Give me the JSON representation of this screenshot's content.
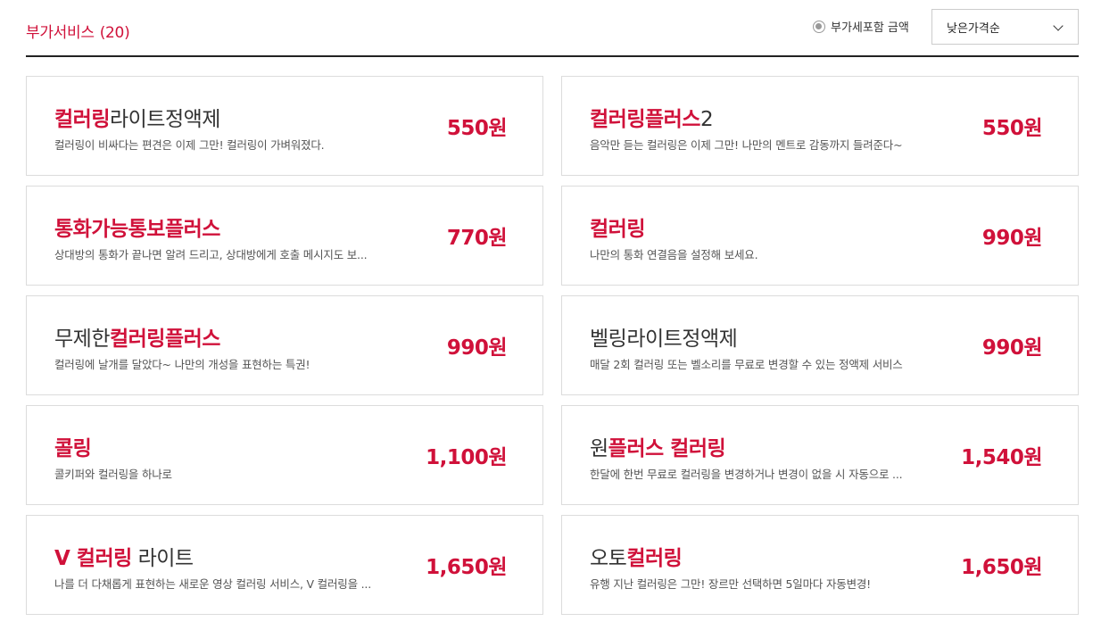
{
  "header": {
    "title": "부가서비스",
    "count": "(20)",
    "vat_label": "부가세포함 금액",
    "sort_value": "낮은가격순"
  },
  "colors": {
    "accent": "#d0113a",
    "text": "#333333",
    "border": "#dcdcdc"
  },
  "icons": {
    "vat": "radio-icon",
    "sort": "chevron-down-icon"
  },
  "services": [
    {
      "name_parts": [
        {
          "text": "컬러링",
          "hl": true
        },
        {
          "text": "라이트정액제",
          "hl": false
        }
      ],
      "desc": "컬러링이 비싸다는 편견은 이제 그만! 컬러링이 가벼워졌다.",
      "price": "550원"
    },
    {
      "name_parts": [
        {
          "text": "컬러링플러스",
          "hl": true
        },
        {
          "text": "2",
          "hl": false
        }
      ],
      "desc": "음악만 듣는 컬러링은 이제 그만! 나만의 멘트로 감동까지 들려준다~",
      "price": "550원"
    },
    {
      "name_parts": [
        {
          "text": "통화가능통보플러스",
          "hl": true
        }
      ],
      "desc": "상대방의 통화가 끝나면 알려 드리고, 상대방에게 호출 메시지도 보...",
      "price": "770원"
    },
    {
      "name_parts": [
        {
          "text": "컬러링",
          "hl": true
        }
      ],
      "desc": "나만의 통화 연결음을 설정해 보세요.",
      "price": "990원"
    },
    {
      "name_parts": [
        {
          "text": "무제한",
          "hl": false
        },
        {
          "text": "컬러링플러스",
          "hl": true
        }
      ],
      "desc": "컬러링에 날개를 달았다~ 나만의 개성을 표현하는 특권!",
      "price": "990원"
    },
    {
      "name_parts": [
        {
          "text": "벨링라이트정액제",
          "hl": false
        }
      ],
      "desc": "매달 2회 컬러링 또는 벨소리를 무료로 변경할 수 있는 정액제 서비스",
      "price": "990원"
    },
    {
      "name_parts": [
        {
          "text": "콜링",
          "hl": true
        }
      ],
      "desc": "콜키퍼와 컬러링을 하나로",
      "price": "1,100원"
    },
    {
      "name_parts": [
        {
          "text": "원",
          "hl": false
        },
        {
          "text": "플러스 컬러링",
          "hl": true
        }
      ],
      "desc": "한달에 한번 무료로 컬러링을 변경하거나 변경이 없을 시 자동으로 ...",
      "price": "1,540원"
    },
    {
      "name_parts": [
        {
          "text": "V 컬러링",
          "hl": true
        },
        {
          "text": " 라이트",
          "hl": false
        }
      ],
      "desc": "나를 더 다채롭게 표현하는 새로운 영상 컬러링 서비스, V 컬러링을 ...",
      "price": "1,650원"
    },
    {
      "name_parts": [
        {
          "text": "오토",
          "hl": false
        },
        {
          "text": "컬러링",
          "hl": true
        }
      ],
      "desc": "유행 지난 컬러링은 그만! 장르만 선택하면 5일마다 자동변경!",
      "price": "1,650원"
    }
  ]
}
